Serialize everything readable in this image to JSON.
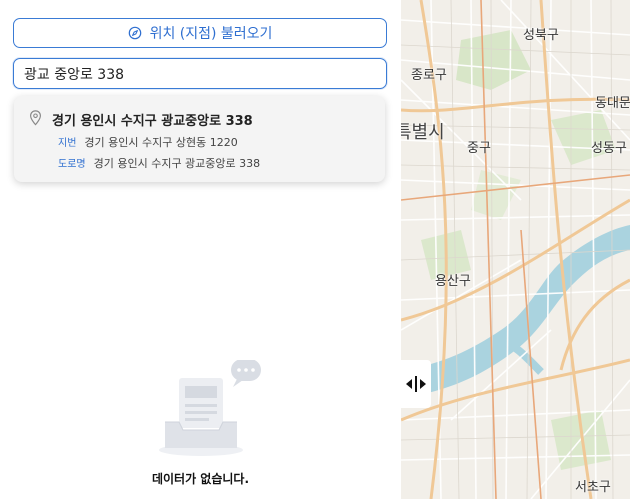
{
  "left_panel": {
    "load_location_button": "위치 (지점) 불러오기",
    "search": {
      "value": "광교 중앙로 338"
    },
    "suggestion": {
      "title": "경기 용인시 수지구 광교중앙로 338",
      "jibun_tag": "지번",
      "jibun_address": "경기 용인시 수지구 상현동 1220",
      "road_tag": "도로명",
      "road_address": "경기 용인시 수지구 광교중앙로 338"
    },
    "empty_state": {
      "text": "데이터가 없습니다."
    }
  },
  "map": {
    "labels": [
      "성북구",
      "종로구",
      "동대문",
      "특별시",
      "중구",
      "성동구",
      "용산구",
      "서초구"
    ],
    "river_color": "#aad3df",
    "road_color": "#f0c896"
  },
  "icons": {
    "load_button": "compass-icon",
    "suggestion": "map-pin-icon",
    "empty_state": "empty-inbox-icon",
    "splitter": "resize-horizontal-icon"
  },
  "colors": {
    "accent": "#2f6fd0"
  }
}
